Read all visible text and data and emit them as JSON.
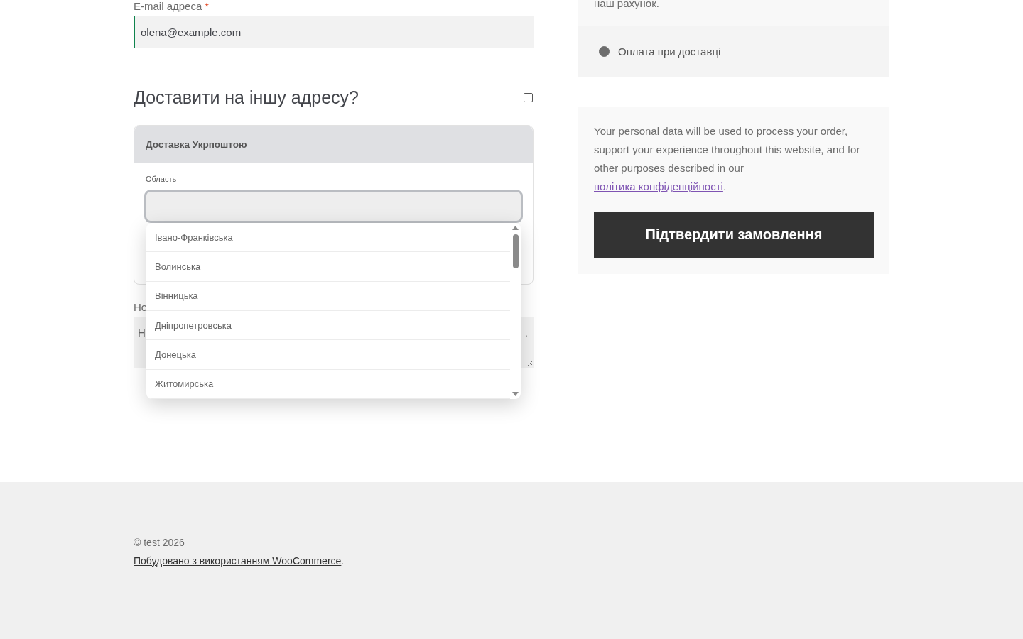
{
  "billing": {
    "email_label": "E-mail адреса",
    "required_mark": "*",
    "email_value": "olena@example.com"
  },
  "ship_elsewhere": {
    "heading": "Доставити на іншу адресу?",
    "checked": false
  },
  "delivery_card": {
    "title": "Доставка Укрпоштою",
    "region_label": "Область",
    "dropdown_options": [
      {
        "label": "Івано-Франківська"
      },
      {
        "label": "Волинська"
      },
      {
        "label": "Вінницька"
      },
      {
        "label": "Дніпропетровська"
      },
      {
        "label": "Донецька"
      },
      {
        "label": "Житомирська"
      }
    ]
  },
  "notes": {
    "label": "Но",
    "placeholder_start": "Н",
    "placeholder_end": "."
  },
  "payment": {
    "previous_text": "наш рахунок.",
    "methods": [
      {
        "label": "Оплата при доставці",
        "selected": true
      }
    ]
  },
  "privacy": {
    "text": "Your personal data will be used to process your order, support your experience throughout this website, and for other purposes described in our ",
    "link": "політика конфіденційності",
    "end": "."
  },
  "place_order": "Підтвердити замовлення",
  "footer": {
    "copyright": "© test 2026",
    "credit_link": "Побудовано з використанням WooCommerce",
    "credit_end": "."
  }
}
